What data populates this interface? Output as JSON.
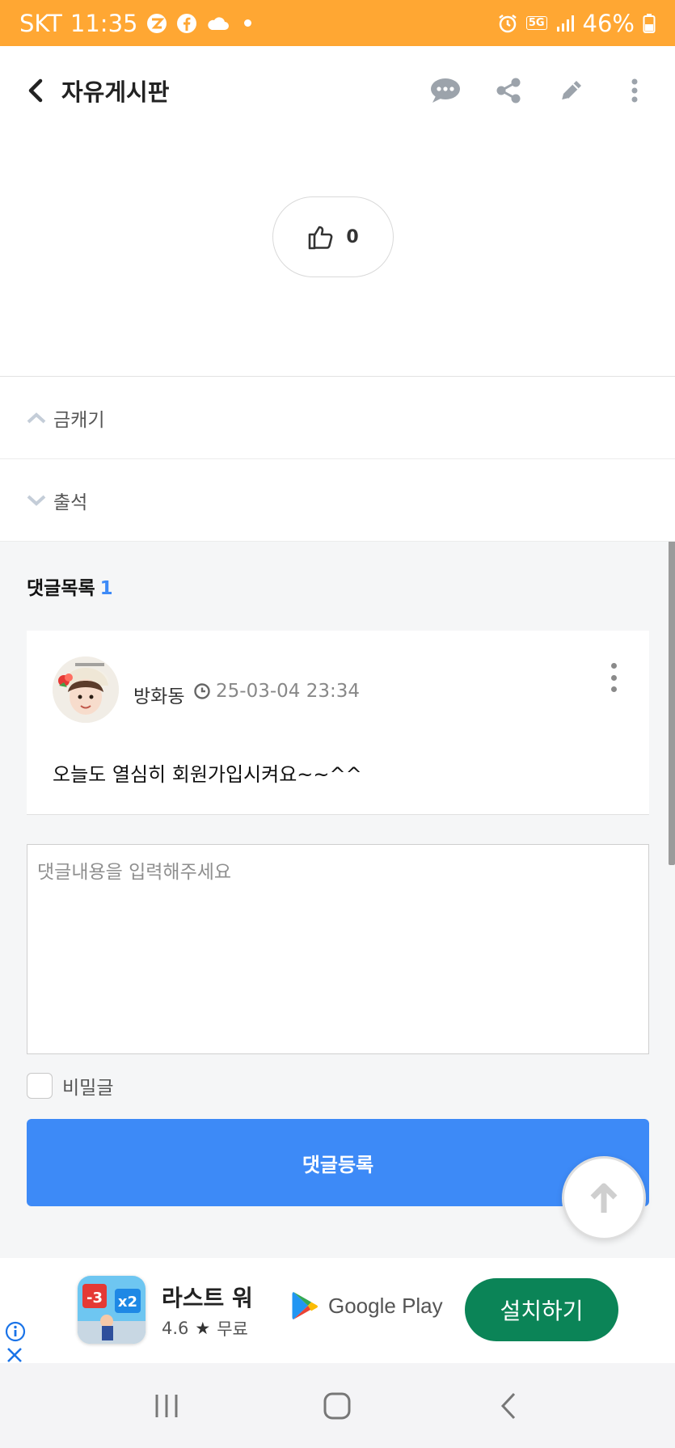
{
  "status_bar": {
    "carrier": "SKT",
    "time": "11:35",
    "network": "5G",
    "battery": "46%",
    "background_color": "#ffa733",
    "icons": [
      "zum-icon",
      "facebook-icon",
      "cloud-icon",
      "alarm-icon",
      "signal-icon",
      "battery-icon"
    ]
  },
  "header": {
    "title": "자유게시판",
    "actions": [
      "comment-icon",
      "share-icon",
      "edit-icon",
      "more-vertical-icon"
    ]
  },
  "like": {
    "count": "0"
  },
  "post_nav": {
    "prev_label": "금캐기",
    "next_label": "출석"
  },
  "comments": {
    "heading": "댓글목록",
    "count": "1",
    "items": [
      {
        "author": "방화동",
        "datetime": "25-03-04 23:34",
        "text": "오늘도 열심히 회원가입시켜요~~^^"
      }
    ]
  },
  "comment_form": {
    "placeholder": "댓글내용을 입력해주세요",
    "secret_label": "비밀글",
    "submit_label": "댓글등록"
  },
  "ad": {
    "app_name": "라스트 워",
    "rating": "4.6",
    "star": "★",
    "price": "무료",
    "store_label": "Google Play",
    "install_label": "설치하기",
    "icon_badges": [
      "-3",
      "x2"
    ],
    "install_color": "#0b8457"
  },
  "accent_color": "#3d8af7"
}
